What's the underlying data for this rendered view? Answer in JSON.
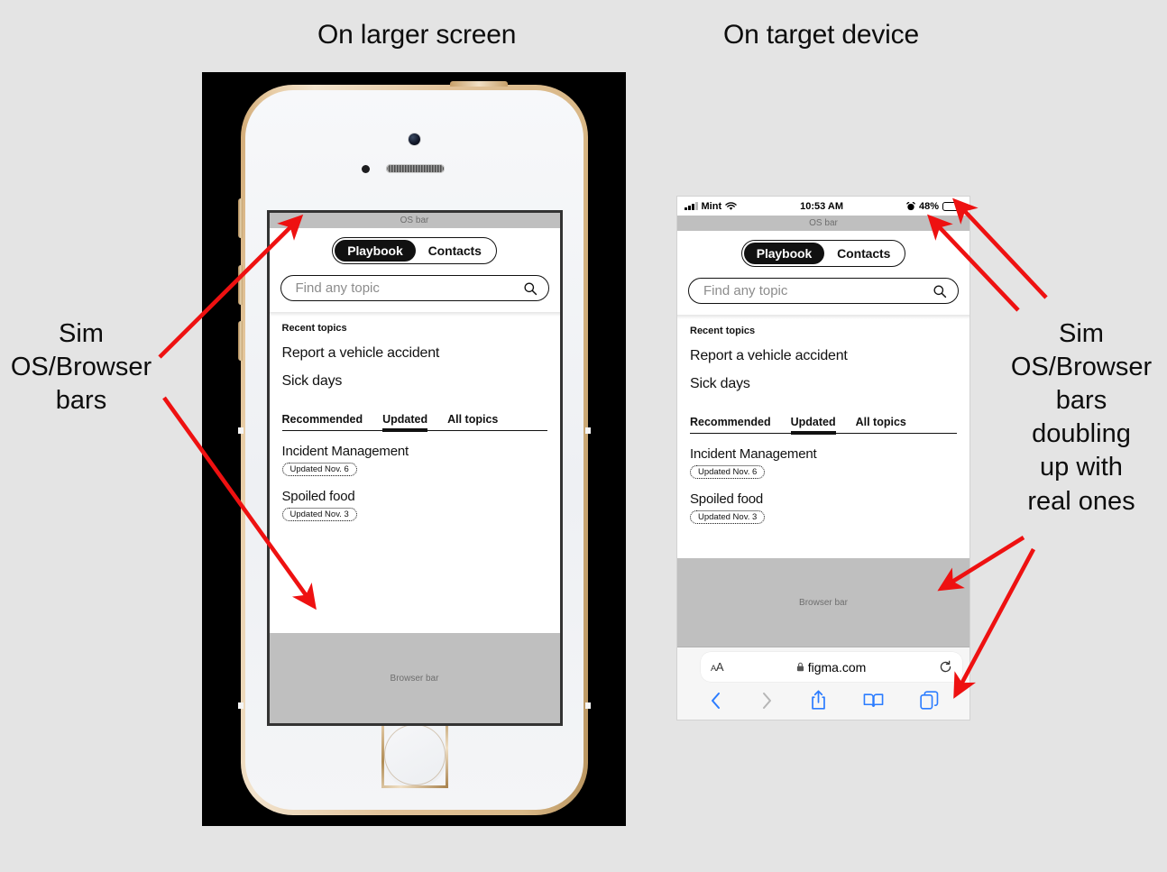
{
  "headings": {
    "left": "On larger screen",
    "right": "On target device"
  },
  "annotations": {
    "left": "Sim\nOS/Browser\nbars",
    "right": "Sim\nOS/Browser\nbars\ndoubling\nup with\nreal ones"
  },
  "sim": {
    "os_bar_label": "OS bar",
    "browser_bar_label": "Browser bar",
    "segmented": [
      {
        "label": "Playbook",
        "active": true
      },
      {
        "label": "Contacts",
        "active": false
      }
    ],
    "search_placeholder": "Find any topic",
    "search_icon": "search-icon",
    "recent_label": "Recent topics",
    "recent_topics": [
      "Report a vehicle accident",
      "Sick days"
    ],
    "tabs": [
      {
        "label": "Recommended",
        "active": false
      },
      {
        "label": "Updated",
        "active": true
      },
      {
        "label": "All topics",
        "active": false
      }
    ],
    "articles": [
      {
        "title": "Incident Management",
        "chip": "Updated Nov. 6"
      },
      {
        "title": "Spoiled food",
        "chip": "Updated Nov. 3"
      }
    ]
  },
  "ios_status": {
    "carrier": "Mint",
    "time": "10:53 AM",
    "battery_percent": "48%",
    "signal_icon": "cellular-signal-icon",
    "wifi_icon": "wifi-icon",
    "alarm_icon": "alarm-clock-icon",
    "battery_icon": "battery-icon",
    "battery_fill": 48
  },
  "safari": {
    "text_size_label": "AA",
    "url": "figma.com",
    "lock_icon": "lock-icon",
    "reload_icon": "reload-icon",
    "back_icon": "chevron-left-icon",
    "forward_icon": "chevron-right-icon",
    "share_icon": "share-icon",
    "bookmarks_icon": "book-icon",
    "tabs_icon": "tabs-icon",
    "accent": "#2b7cff"
  },
  "colors": {
    "page_bg": "#e4e4e4",
    "arrow_red": "#ee1111",
    "fake_bar_gray": "#bfbfbf",
    "plate_black": "#000000"
  }
}
